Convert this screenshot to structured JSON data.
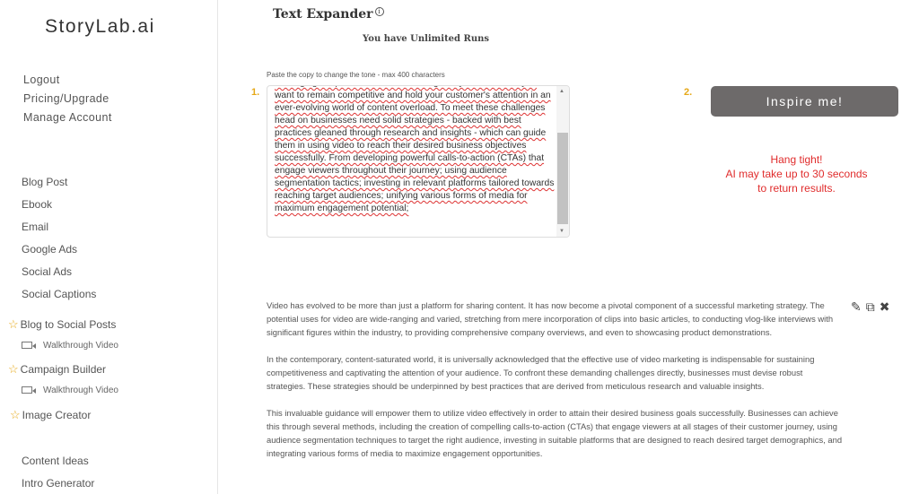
{
  "logo": "StoryLab.ai",
  "account": [
    "Logout",
    "Pricing/Upgrade",
    "Manage Account"
  ],
  "nav": {
    "items": [
      "Blog Post",
      "Ebook",
      "Email",
      "Google Ads",
      "Social Ads",
      "Social Captions"
    ],
    "starred": [
      {
        "label": "Blog to Social Posts",
        "sub": "Walkthrough Video"
      },
      {
        "label": "Campaign Builder",
        "sub": "Walkthrough Video"
      },
      {
        "label": "Image Creator"
      }
    ],
    "more": [
      "Content Ideas",
      "Intro Generator"
    ]
  },
  "header": {
    "title": "Text Expander",
    "runs": "You have Unlimited Runs"
  },
  "input": {
    "hint": "Paste the copy to change the tone - max 400 characters",
    "step": "1.",
    "value": "leveraging the power of video marketing today is essential if you want to remain competitive and hold your customer's attention in an ever-evolving world of content overload. To meet these challenges head on businesses need solid strategies - backed with best practices gleaned through research and insights - which can guide them in using video to reach their desired business objectives successfully. From developing powerful calls-to-action (CTAs) that engage viewers throughout their journey; using audience segmentation tactics; investing in relevant platforms tailored towards reaching target audiences; unifying various forms of media for maximum engagement potential;"
  },
  "action": {
    "step": "2.",
    "button": "Inspire me!",
    "wait": [
      "Hang tight!",
      "AI may take up to 30 seconds",
      "to return results."
    ]
  },
  "output": [
    "Video has evolved to be more than just a platform for sharing content. It has now become a pivotal component of a successful marketing strategy. The potential uses for video are wide-ranging and varied, stretching from mere incorporation of clips into basic articles, to conducting vlog-like interviews with significant figures within the industry, to providing comprehensive company overviews, and even to showcasing product demonstrations.",
    "In the contemporary, content-saturated world, it is universally acknowledged that the effective use of video marketing is indispensable for sustaining competitiveness and captivating the attention of your audience. To confront these demanding challenges directly, businesses must devise robust strategies. These strategies should be underpinned by best practices that are derived from meticulous research and valuable insights.",
    "This invaluable guidance will empower them to utilize video effectively in order to attain their desired business goals successfully. Businesses can achieve this through several methods, including the creation of compelling calls-to-action (CTAs) that engage viewers at all stages of their customer journey, using audience segmentation techniques to target the right audience, investing in suitable platforms that are designed to reach desired target demographics, and integrating various forms of media to maximize engagement opportunities."
  ],
  "colors": {
    "accent": "#e6a817",
    "button": "#6d6a6a",
    "warning": "#e02c2c"
  }
}
